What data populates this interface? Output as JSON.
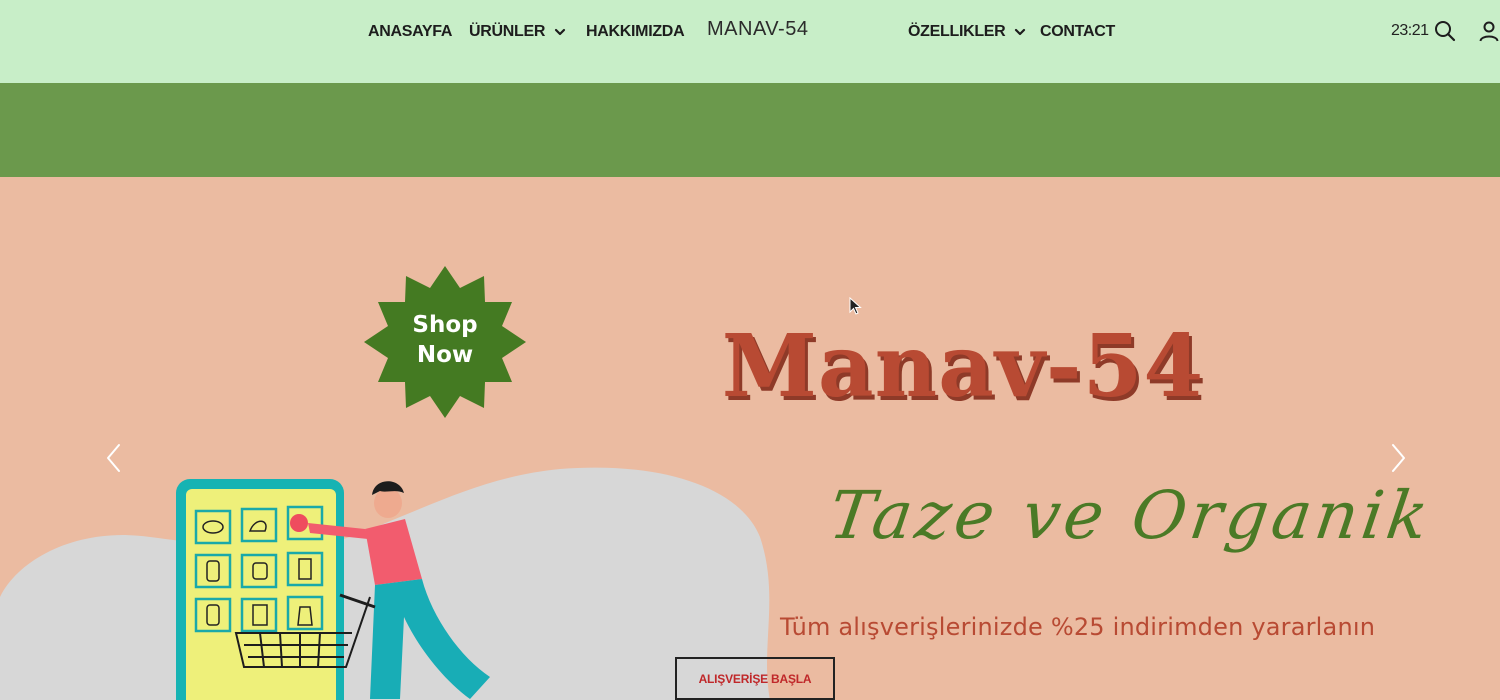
{
  "nav": {
    "items": [
      {
        "label": "ANASAYFA",
        "has_dropdown": false
      },
      {
        "label": "ÜRÜNLER",
        "has_dropdown": true
      },
      {
        "label": "HAKKIMIZDA",
        "has_dropdown": false
      },
      {
        "label": "ÖZELLIKLER",
        "has_dropdown": true
      },
      {
        "label": "CONTACT",
        "has_dropdown": false
      }
    ],
    "brand": "MANAV-54",
    "clock": "23:21",
    "icons": [
      "search-icon",
      "user-icon"
    ]
  },
  "hero": {
    "badge": {
      "line1": "Shop",
      "line2": "Now"
    },
    "title": "Manav-54",
    "tagline": "Taze ve Organik",
    "promo": "Tüm alışverişlerinizde %25 indirimden yararlanın",
    "cta_label": "ALIŞVERİŞE BAŞLA",
    "arrows": [
      "chevron-left-icon",
      "chevron-right-icon"
    ]
  },
  "colors": {
    "nav_bg": "#c8eec8",
    "band_green": "#6b994c",
    "hero_bg": "#ebbba1",
    "badge_green": "#447a22",
    "title_red": "#b84a33",
    "script_green": "#4b7a26",
    "cta_text": "#c0282a"
  }
}
